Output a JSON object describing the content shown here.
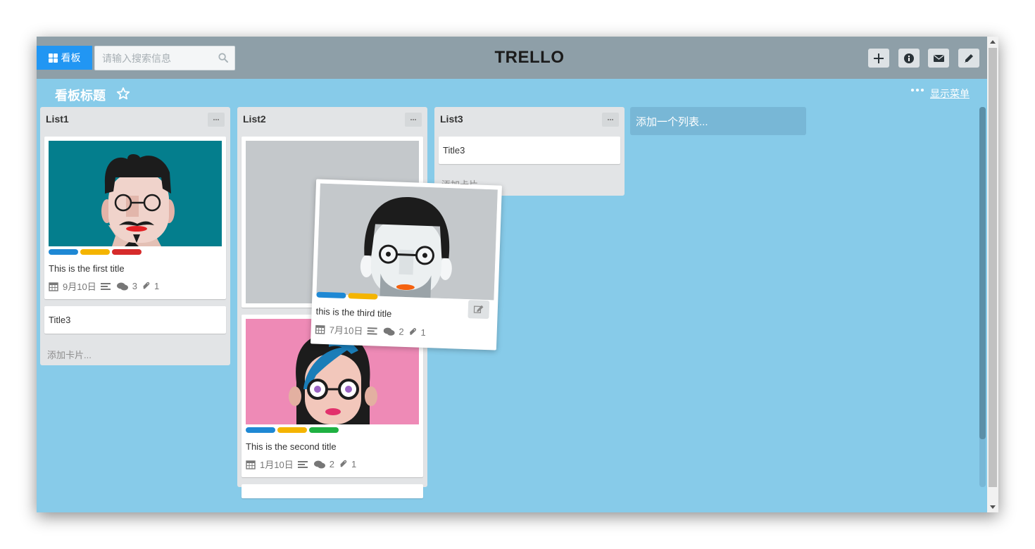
{
  "header": {
    "board_button_label": "看板",
    "search_placeholder": "请输入搜索信息",
    "app_title": "TRELLO",
    "tools": [
      "plus-icon",
      "info-icon",
      "envelope-icon",
      "pencil-icon"
    ]
  },
  "board": {
    "title": "看板标题",
    "show_menu_label": "显示菜单",
    "add_list_label": "添加一个列表..."
  },
  "lists": [
    {
      "title": "List1",
      "cards": [
        {
          "image": "avatar-man-with-mustache",
          "labels": [
            "#1e88d4",
            "#f4b400",
            "#d62b2b"
          ],
          "title": "This is the first title",
          "date": "9月10日",
          "comments": "3",
          "attachments": "1"
        },
        {
          "title": "Title3"
        }
      ],
      "add_card_label": "添加卡片..."
    },
    {
      "title": "List2",
      "cards": [
        {
          "image": "image-placeholder-gray"
        },
        {
          "image": "avatar-woman-blue-hair",
          "labels": [
            "#1e88d4",
            "#f4b400",
            "#1fb142"
          ],
          "title": "This is the second title",
          "date": "1月10日",
          "comments": "2",
          "attachments": "1"
        }
      ]
    },
    {
      "title": "List3",
      "cards": [
        {
          "title": "Title3"
        }
      ],
      "add_card_label": "添加卡片..."
    }
  ],
  "dragging_card": {
    "image": "avatar-man-glasses-gray",
    "labels": [
      "#1e88d4",
      "#f4b400"
    ],
    "title": "this is the third title",
    "date": "7月10日",
    "comments": "2",
    "attachments": "1"
  },
  "colors": {
    "board_background": "#87cbe9",
    "header_background": "#8e9fa8",
    "primary_button": "#2196f3",
    "list_background": "#e2e4e6"
  }
}
